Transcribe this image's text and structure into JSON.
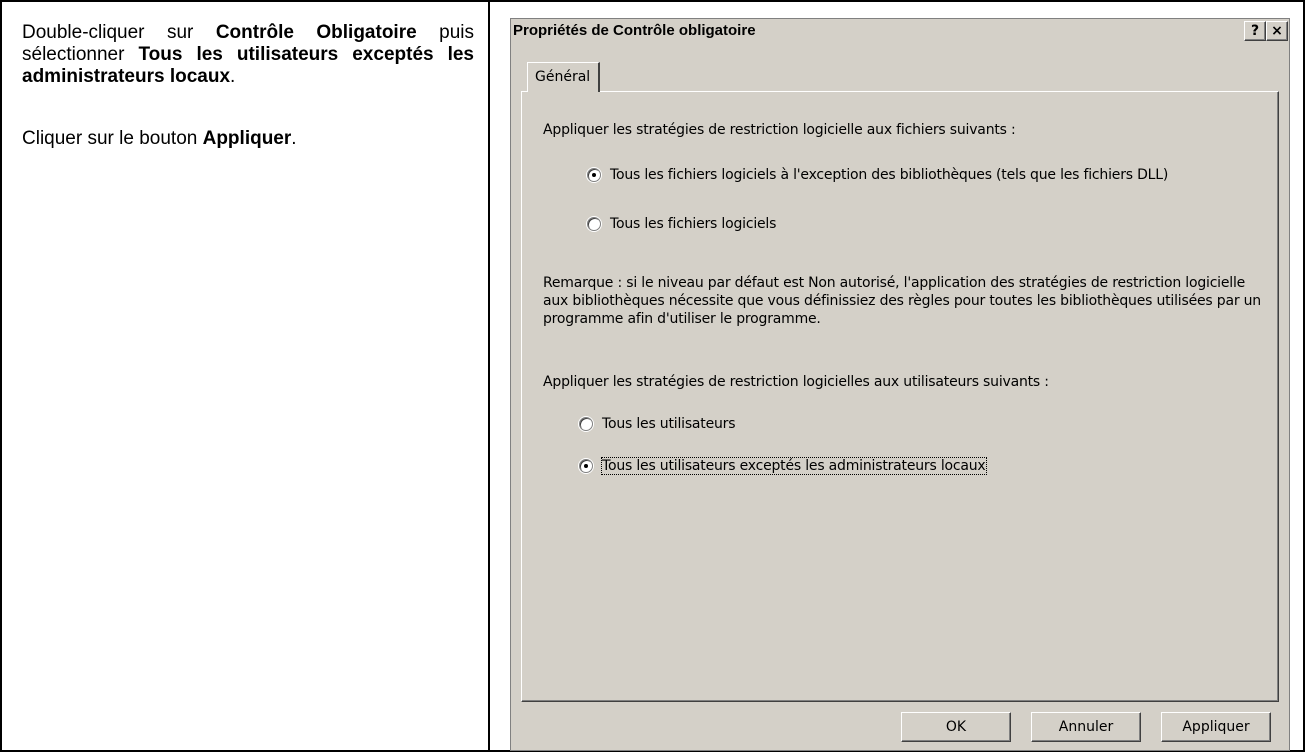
{
  "instructions": {
    "p1_prefix": "Double-cliquer sur ",
    "p1_bold1": "Contrôle Obligatoire",
    "p1_middle": " puis sélectionner ",
    "p1_bold2": "Tous les utilisateurs exceptés les administrateurs locaux",
    "p1_end": ".",
    "p2_prefix": "Cliquer sur le bouton ",
    "p2_bold": "Appliquer",
    "p2_end": "."
  },
  "dialog": {
    "title": "Propriétés de Contrôle obligatoire",
    "help_label": "?",
    "close_label": "×",
    "tab_label": "Général",
    "section1_label": "Appliquer les stratégies de restriction logicielle aux fichiers suivants :",
    "files_options": [
      {
        "label": "Tous les fichiers logiciels à l'exception des bibliothèques (tels que les fichiers DLL)",
        "checked": true
      },
      {
        "label": "Tous les fichiers logiciels",
        "checked": false
      }
    ],
    "note": "Remarque : si le niveau par défaut est Non autorisé, l'application des stratégies de restriction logicielle aux bibliothèques nécessite que vous définissiez des règles pour toutes les bibliothèques utilisées par un programme afin d'utiliser le programme.",
    "section2_label": "Appliquer les stratégies de restriction logicielles aux utilisateurs suivants :",
    "user_options": [
      {
        "label": "Tous les utilisateurs",
        "checked": false
      },
      {
        "label": "Tous les utilisateurs exceptés les administrateurs locaux",
        "checked": true
      }
    ],
    "buttons": {
      "ok": "OK",
      "cancel": "Annuler",
      "apply": "Appliquer"
    }
  }
}
